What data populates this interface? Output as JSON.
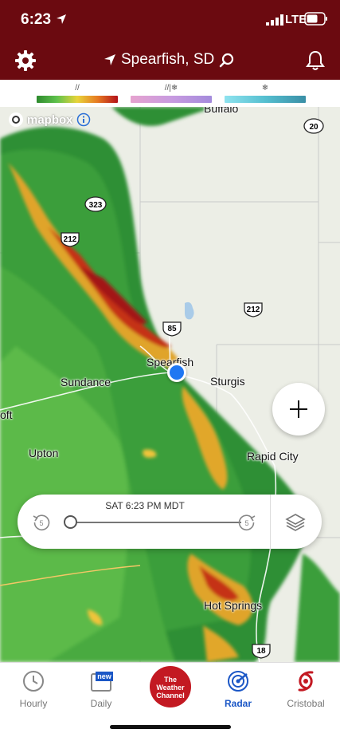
{
  "status": {
    "time": "6:23",
    "network": "LTE"
  },
  "header": {
    "location": "Spearfish, SD"
  },
  "legend": {
    "rain_glyph": "//",
    "mix_glyph": "//|❄",
    "snow_glyph": "❄"
  },
  "colors": {
    "header_bg": "#6b0a10",
    "accent_blue": "#1b57c6",
    "brand_red": "#c31922"
  },
  "map": {
    "attribution": "mapbox",
    "labels": [
      {
        "id": "buffalo",
        "text": "Buffalo"
      },
      {
        "id": "spearfish",
        "text": "Spearfish"
      },
      {
        "id": "sundance",
        "text": "Sundance"
      },
      {
        "id": "sturgis",
        "text": "Sturgis"
      },
      {
        "id": "oft",
        "text": "oft"
      },
      {
        "id": "upton",
        "text": "Upton"
      },
      {
        "id": "rapid-city",
        "text": "Rapid City"
      },
      {
        "id": "hot-springs",
        "text": "Hot Springs"
      }
    ],
    "shields": [
      "20",
      "323",
      "212",
      "212",
      "85",
      "18"
    ]
  },
  "timeline": {
    "time_label": "SAT 6:23 PM MDT",
    "progress": 0
  },
  "tabs": [
    {
      "label": "Hourly",
      "icon": "clock-icon"
    },
    {
      "label": "Daily",
      "icon": "calendar-icon",
      "badge": "new"
    },
    {
      "label": "The Weather Channel",
      "icon": "twc-logo"
    },
    {
      "label": "Radar",
      "icon": "radar-icon",
      "active": true
    },
    {
      "label": "Cristobal",
      "icon": "hurricane-icon"
    }
  ]
}
